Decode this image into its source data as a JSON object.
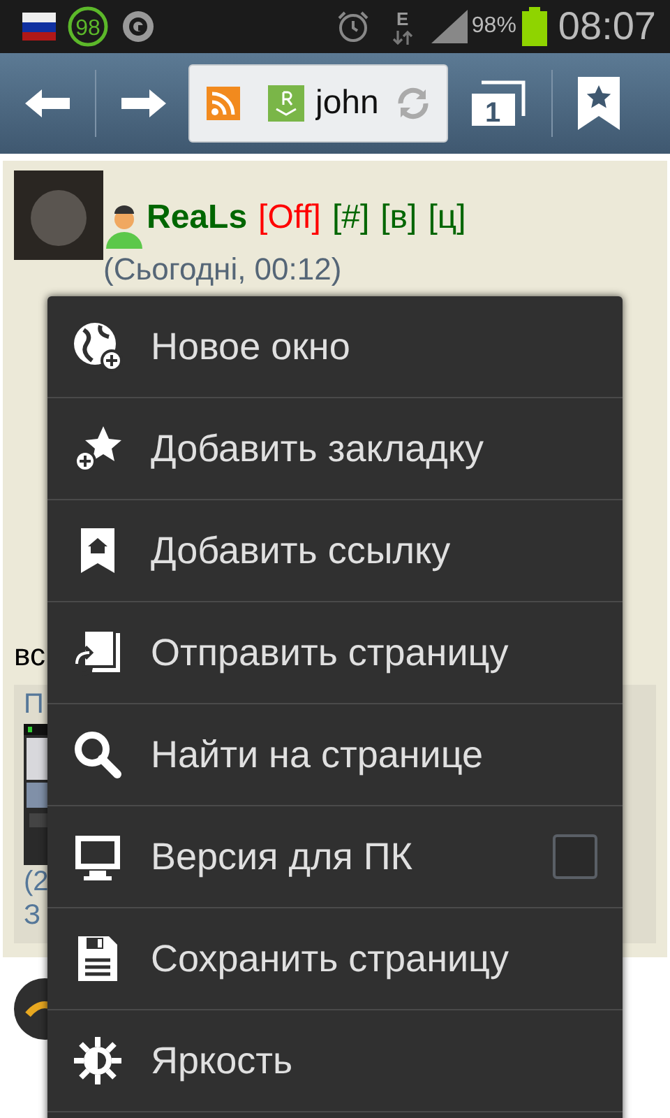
{
  "status_bar": {
    "badge": "98",
    "network": "E",
    "battery": "98%",
    "time": "08:07"
  },
  "toolbar": {
    "address": "john",
    "tabs_count": "1"
  },
  "post": {
    "author": "ReaLs",
    "tags": [
      {
        "text": "[Off]",
        "color": "#ff0000"
      },
      {
        "text": "[#]",
        "color": "#006600"
      },
      {
        "text": "[в]",
        "color": "#006600"
      },
      {
        "text": "[ц]",
        "color": "#006600"
      }
    ],
    "date": "(Сьогодні, 00:12)",
    "text_fragment": "вс",
    "quote": {
      "title_fragment": "П",
      "line_1": "(2",
      "line_2": "З"
    }
  },
  "menu": [
    {
      "kind": "globe",
      "label": "Новое окно"
    },
    {
      "kind": "star",
      "label": "Добавить закладку"
    },
    {
      "kind": "home",
      "label": "Добавить ссылку"
    },
    {
      "kind": "send",
      "label": "Отправить страницу"
    },
    {
      "kind": "search",
      "label": "Найти на странице"
    },
    {
      "kind": "desktop",
      "label": "Версия для ПК",
      "checked": false
    },
    {
      "kind": "save",
      "label": "Сохранить страницу"
    },
    {
      "kind": "brightness",
      "label": "Яркость"
    }
  ]
}
